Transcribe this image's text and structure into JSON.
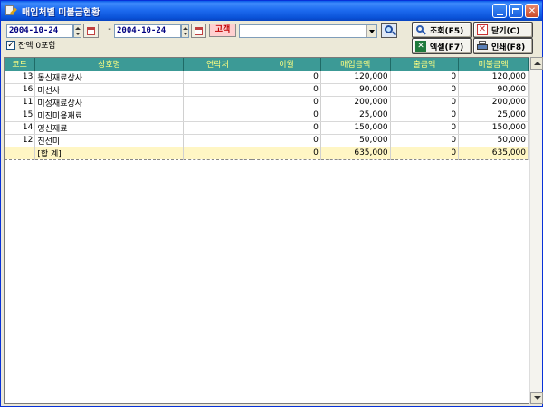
{
  "window": {
    "title": "매입처별 미불금현황"
  },
  "filters": {
    "date_from": "2004-10-24",
    "date_to": "2004-10-24",
    "date_separator": "-",
    "customer_label": "고객",
    "customer_value": "",
    "include_balance_label": "잔액 0포함",
    "include_balance_checked": true
  },
  "buttons": {
    "search": "조회(F5)",
    "close": "닫기(C)",
    "excel": "엑셀(F7)",
    "print": "인쇄(F8)"
  },
  "table": {
    "columns": [
      "코드",
      "상호명",
      "연락처",
      "이월",
      "매입금액",
      "출금액",
      "미불금액"
    ],
    "rows": [
      {
        "code": "13",
        "name": "동신재료상사",
        "contact": "",
        "carry": "0",
        "purchase": "120,000",
        "payment": "0",
        "unpaid": "120,000"
      },
      {
        "code": "16",
        "name": "미선사",
        "contact": "",
        "carry": "0",
        "purchase": "90,000",
        "payment": "0",
        "unpaid": "90,000"
      },
      {
        "code": "11",
        "name": "미성재료상사",
        "contact": "",
        "carry": "0",
        "purchase": "200,000",
        "payment": "0",
        "unpaid": "200,000"
      },
      {
        "code": "15",
        "name": "미진미용재료",
        "contact": "",
        "carry": "0",
        "purchase": "25,000",
        "payment": "0",
        "unpaid": "25,000"
      },
      {
        "code": "14",
        "name": "영신재료",
        "contact": "",
        "carry": "0",
        "purchase": "150,000",
        "payment": "0",
        "unpaid": "150,000"
      },
      {
        "code": "12",
        "name": "진선미",
        "contact": "",
        "carry": "0",
        "purchase": "50,000",
        "payment": "0",
        "unpaid": "50,000"
      }
    ],
    "total": {
      "code": "",
      "name": "[합 계]",
      "contact": "",
      "carry": "0",
      "purchase": "635,000",
      "payment": "0",
      "unpaid": "635,000"
    }
  }
}
